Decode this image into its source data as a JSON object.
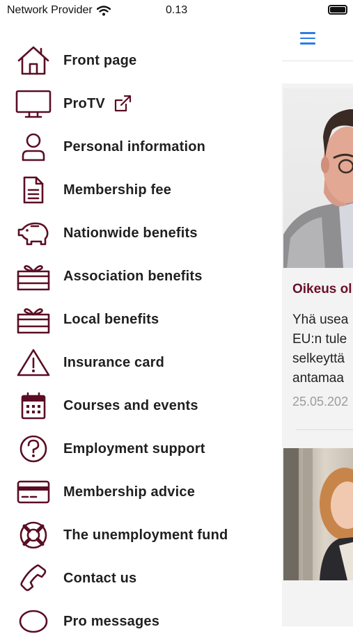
{
  "status_bar": {
    "carrier": "Network Provider",
    "time": "0.13"
  },
  "menu": {
    "items": [
      {
        "label": "Front page",
        "icon": "home-icon"
      },
      {
        "label": "ProTV",
        "icon": "monitor-icon",
        "external_icon": "external-link-icon"
      },
      {
        "label": "Personal information",
        "icon": "user-icon"
      },
      {
        "label": "Membership fee",
        "icon": "document-icon"
      },
      {
        "label": "Nationwide benefits",
        "icon": "piggy-bank-icon"
      },
      {
        "label": "Association benefits",
        "icon": "gift-icon"
      },
      {
        "label": "Local benefits",
        "icon": "gift-icon"
      },
      {
        "label": "Insurance card",
        "icon": "warning-icon"
      },
      {
        "label": "Courses and events",
        "icon": "calendar-icon"
      },
      {
        "label": "Employment support",
        "icon": "question-icon"
      },
      {
        "label": "Membership advice",
        "icon": "credit-card-icon"
      },
      {
        "label": "The unemployment fund",
        "icon": "lifebuoy-icon"
      },
      {
        "label": "Contact us",
        "icon": "phone-icon"
      },
      {
        "label": "Pro messages",
        "icon": "chat-bubble-icon"
      }
    ]
  },
  "content": {
    "menu_icon": "hamburger-icon",
    "article": {
      "title": "Oikeus ol",
      "text": "Yhä usea\nEU:n tule\nselkeyttä\nantamaa",
      "date": "25.05.202"
    }
  },
  "colors": {
    "icon": "#5a0d24",
    "accent_title": "#6a1129",
    "hamburger": "#2b7de1"
  }
}
